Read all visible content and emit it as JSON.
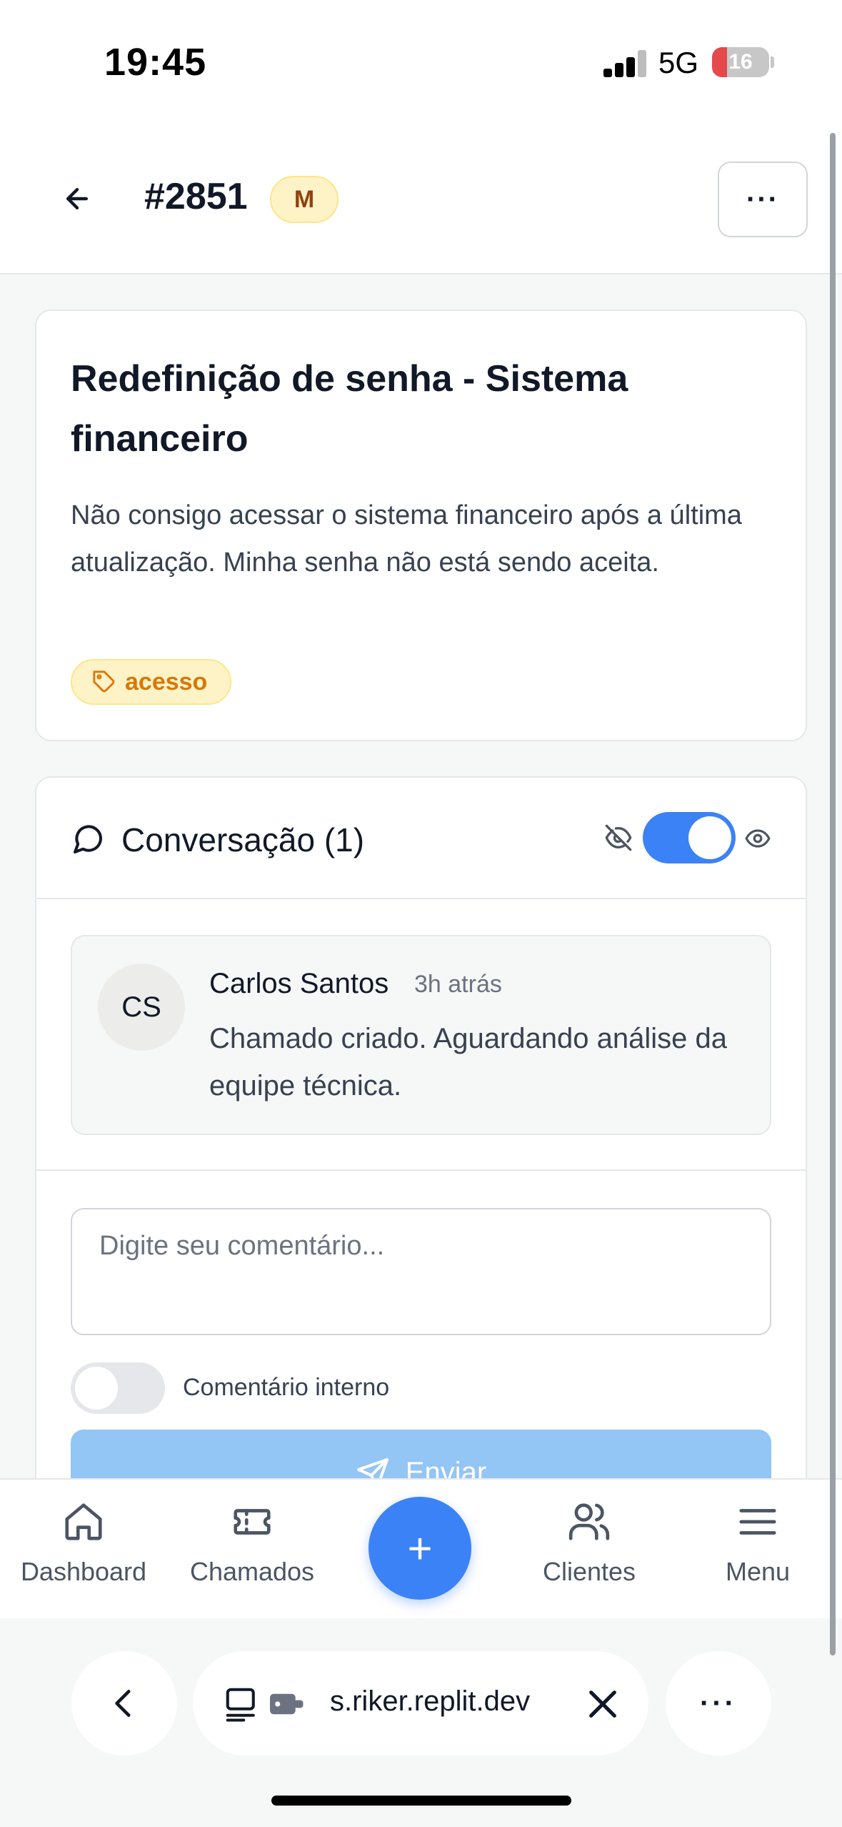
{
  "status_bar": {
    "time": "19:45",
    "network": "5G",
    "battery": "16"
  },
  "header": {
    "ticket_id": "#2851",
    "priority_badge": "M",
    "more_label": "···"
  },
  "ticket": {
    "title": "Redefinição de senha - Sistema financeiro",
    "description": "Não consigo acessar o sistema financeiro após a última atualização. Minha senha não está sendo aceita.",
    "tag": "acesso"
  },
  "conversation": {
    "title": "Conversação (1)",
    "visibility_toggle_on": true,
    "messages": [
      {
        "initials": "CS",
        "author": "Carlos Santos",
        "time": "3h atrás",
        "text": "Chamado criado. Aguardando análise da equipe técnica."
      }
    ],
    "comment_placeholder": "Digite seu comentário...",
    "internal_label": "Comentário interno",
    "internal_toggle_on": false,
    "send_label": "Enviar"
  },
  "bottom_nav": {
    "items": [
      {
        "label": "Dashboard",
        "icon": "home-icon"
      },
      {
        "label": "Chamados",
        "icon": "ticket-icon"
      },
      {
        "label": "Clientes",
        "icon": "users-icon"
      },
      {
        "label": "Menu",
        "icon": "menu-icon"
      }
    ],
    "fab_label": "+"
  },
  "browser": {
    "url": "s.riker.replit.dev",
    "more_label": "···"
  },
  "colors": {
    "accent": "#3b82f6",
    "badge_bg": "#fef3c7",
    "tag_text": "#d97706"
  }
}
